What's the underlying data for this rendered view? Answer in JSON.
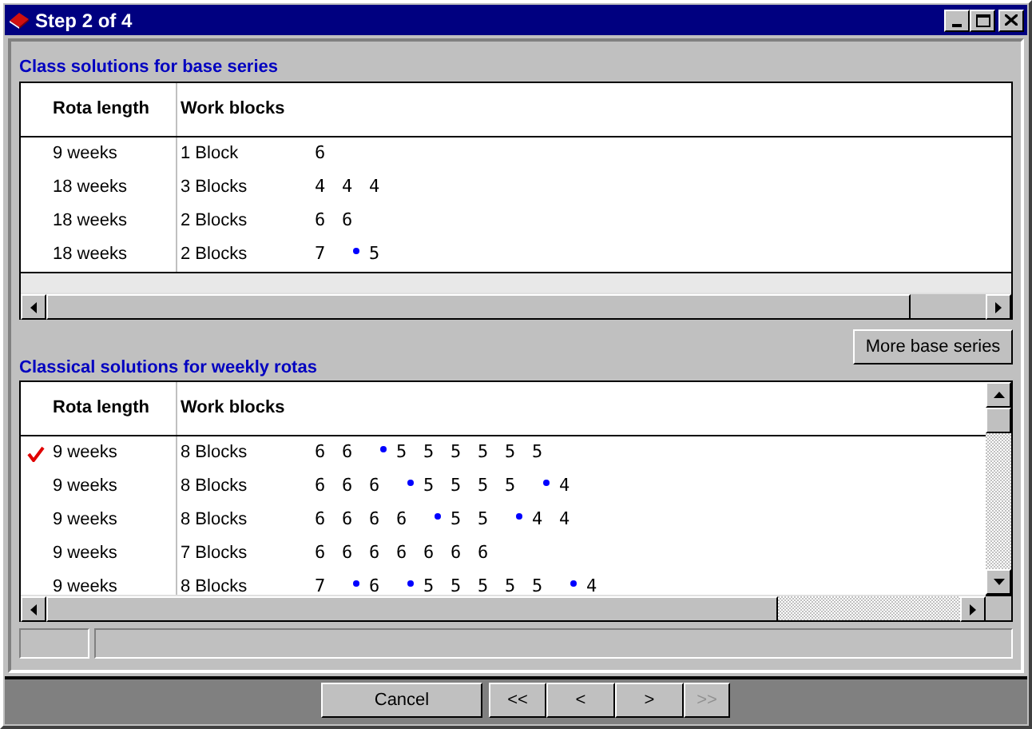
{
  "window": {
    "title": "Step 2 of 4"
  },
  "base_series": {
    "heading": "Class solutions for base series",
    "columns": [
      "Rota length",
      "Work blocks"
    ],
    "rows": [
      {
        "length": "9 weeks",
        "blocks": "1 Block",
        "groups": [
          [
            "6"
          ]
        ]
      },
      {
        "length": "18 weeks",
        "blocks": "3 Blocks",
        "groups": [
          [
            "4",
            "4",
            "4"
          ]
        ]
      },
      {
        "length": "18 weeks",
        "blocks": "2 Blocks",
        "groups": [
          [
            "6",
            "6"
          ]
        ]
      },
      {
        "length": "18 weeks",
        "blocks": "2 Blocks",
        "groups": [
          [
            "7"
          ],
          [
            "5"
          ]
        ]
      }
    ]
  },
  "more_button": "More base series",
  "weekly_rotas": {
    "heading": "Classical solutions for weekly rotas",
    "columns": [
      "Rota length",
      "Work blocks"
    ],
    "rows": [
      {
        "checked": true,
        "length": "9 weeks",
        "blocks": "8 Blocks",
        "groups": [
          [
            "6",
            "6"
          ],
          [
            "5",
            "5",
            "5",
            "5",
            "5",
            "5"
          ]
        ]
      },
      {
        "checked": false,
        "length": "9 weeks",
        "blocks": "8 Blocks",
        "groups": [
          [
            "6",
            "6",
            "6"
          ],
          [
            "5",
            "5",
            "5",
            "5"
          ],
          [
            "4"
          ]
        ]
      },
      {
        "checked": false,
        "length": "9 weeks",
        "blocks": "8 Blocks",
        "groups": [
          [
            "6",
            "6",
            "6",
            "6"
          ],
          [
            "5",
            "5"
          ],
          [
            "4",
            "4"
          ]
        ]
      },
      {
        "checked": false,
        "length": "9 weeks",
        "blocks": "7 Blocks",
        "groups": [
          [
            "6",
            "6",
            "6",
            "6",
            "6",
            "6",
            "6"
          ]
        ]
      },
      {
        "checked": false,
        "length": "9 weeks",
        "blocks": "8 Blocks",
        "groups": [
          [
            "7"
          ],
          [
            "6"
          ],
          [
            "5",
            "5",
            "5",
            "5",
            "5"
          ],
          [
            "4"
          ]
        ]
      }
    ]
  },
  "buttons": [
    {
      "label": "Cancel",
      "disabled": false
    },
    {
      "label": "<<",
      "disabled": false
    },
    {
      "label": "<",
      "disabled": false
    },
    {
      "label": ">",
      "disabled": false
    },
    {
      "label": ">>",
      "disabled": true
    }
  ]
}
